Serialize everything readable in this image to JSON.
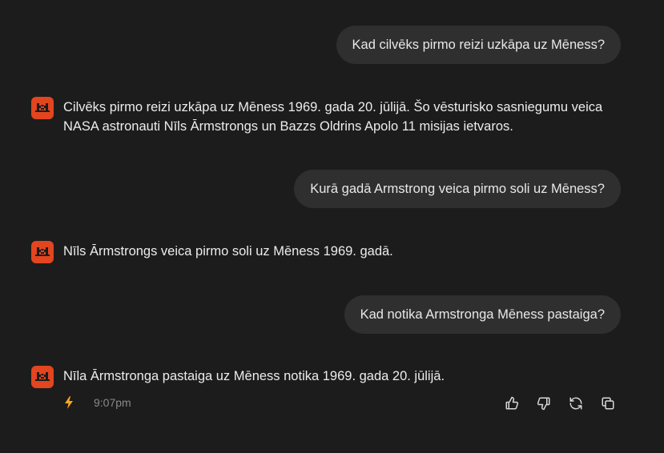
{
  "messages": [
    {
      "role": "user",
      "text": "Kad cilvēks pirmo reizi uzkāpa uz Mēness?"
    },
    {
      "role": "assistant",
      "text": "Cilvēks pirmo reizi uzkāpa uz Mēness 1969. gada 20. jūlijā. Šo vēsturisko sasniegumu veica NASA astronauti Nīls Ārmstrongs un Bazzs Oldrins Apolo 11 misijas ietvaros."
    },
    {
      "role": "user",
      "text": "Kurā gadā Armstrong veica pirmo soli uz Mēness?"
    },
    {
      "role": "assistant",
      "text": "Nīls Ārmstrongs veica pirmo soli uz Mēness 1969. gadā."
    },
    {
      "role": "user",
      "text": "Kad notika Armstronga Mēness pastaiga?"
    },
    {
      "role": "assistant",
      "text": "Nīla Ārmstronga pastaiga uz Mēness notika 1969. gada 20. jūlijā."
    }
  ],
  "meta": {
    "timestamp": "9:07pm",
    "speed_icon": "bolt-icon"
  },
  "actions": [
    {
      "name": "thumbs-up-icon"
    },
    {
      "name": "thumbs-down-icon"
    },
    {
      "name": "regenerate-icon"
    },
    {
      "name": "copy-icon"
    }
  ],
  "colors": {
    "background": "#1c1c1c",
    "user_bubble": "#2f2f2f",
    "avatar": "#e2451f",
    "bolt": "#f5a623"
  }
}
